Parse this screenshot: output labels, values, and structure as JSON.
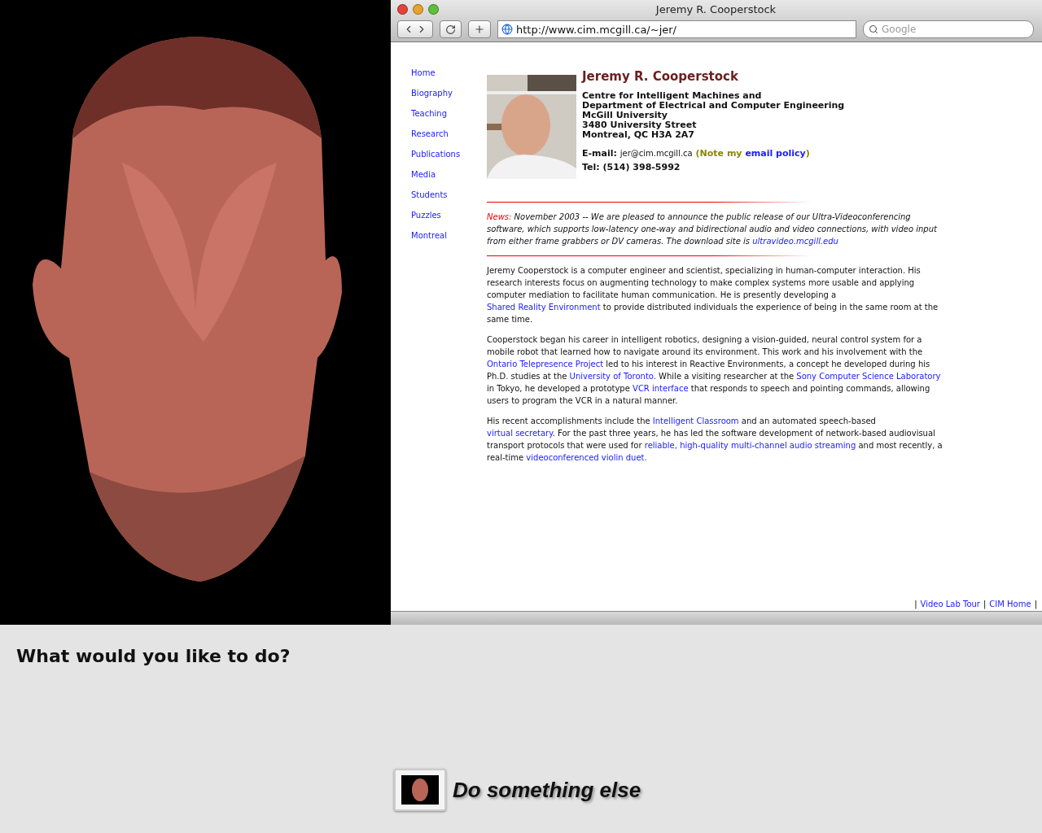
{
  "browser": {
    "title": "Jeremy R. Cooperstock",
    "url": "http://www.cim.mcgill.ca/~jer/",
    "search_placeholder": "Google"
  },
  "nav": [
    "Home",
    "Biography",
    "Teaching",
    "Research",
    "Publications",
    "Media",
    "Students",
    "Puzzles",
    "Montreal"
  ],
  "profile": {
    "name": "Jeremy R. Cooperstock",
    "address_lines": [
      "Centre for Intelligent Machines and",
      "Department of Electrical and Computer Engineering",
      "McGill University",
      "3480 University Street",
      "Montreal, QC H3A 2A7"
    ],
    "email_label": "E-mail:",
    "email": "jer@cim.mcgill.ca",
    "note_open": "(Note my",
    "note_link": "email policy",
    "note_close": ")",
    "tel": "Tel: (514) 398-5992"
  },
  "news": {
    "label": "News:",
    "segments": [
      {
        "kind": "text",
        "text": "November 2003 -- We are pleased to announce the public release of our Ultra-Videoconferencing software, which supports low-latency one-way and bidirectional audio and video connections, with video input from either frame grabbers or DV cameras. The download site is "
      },
      {
        "kind": "link",
        "text": "ultravideo.mcgill.edu"
      }
    ]
  },
  "paragraphs": [
    [
      {
        "kind": "text",
        "text": "Jeremy Cooperstock is a computer engineer and scientist, specializing in human-computer interaction. His research interests focus on augmenting technology to make complex systems more usable and applying computer mediation to facilitate human communication. He is presently developing a "
      },
      {
        "kind": "link",
        "text": "Shared Reality Environment"
      },
      {
        "kind": "text",
        "text": " to provide distributed individuals the experience of being in the same room at the same time."
      }
    ],
    [
      {
        "kind": "text",
        "text": "Cooperstock began his career in intelligent robotics, designing a vision-guided, neural control system for a mobile robot that learned how to navigate around its environment. This work and his involvement with the "
      },
      {
        "kind": "link",
        "text": "Ontario Telepresence Project"
      },
      {
        "kind": "text",
        "text": " led to his interest in Reactive Environments, a concept he developed during his Ph.D. studies at the "
      },
      {
        "kind": "link",
        "text": "University of Toronto"
      },
      {
        "kind": "text",
        "text": ". While a visiting researcher at the "
      },
      {
        "kind": "link",
        "text": "Sony Computer Science Laboratory"
      },
      {
        "kind": "text",
        "text": " in Tokyo, he developed a prototype "
      },
      {
        "kind": "link",
        "text": "VCR interface"
      },
      {
        "kind": "text",
        "text": " that responds to speech and pointing commands, allowing users to program the VCR in a natural manner."
      }
    ],
    [
      {
        "kind": "text",
        "text": "His recent accomplishments include the "
      },
      {
        "kind": "link",
        "text": "Intelligent Classroom"
      },
      {
        "kind": "text",
        "text": " and an automated speech-based "
      },
      {
        "kind": "link",
        "text": "virtual secretary"
      },
      {
        "kind": "text",
        "text": ". For the past three years, he has led the software development of network-based audiovisual transport protocols that were used for "
      },
      {
        "kind": "link",
        "text": "reliable, high-quality multi-channel audio streaming"
      },
      {
        "kind": "text",
        "text": " and most recently, a real-time "
      },
      {
        "kind": "link",
        "text": "videoconferenced violin duet."
      }
    ]
  ],
  "footer": [
    {
      "kind": "sep",
      "text": "|"
    },
    {
      "kind": "link",
      "text": "Video Lab Tour"
    },
    {
      "kind": "sep",
      "text": "|"
    },
    {
      "kind": "link",
      "text": "CIM Home"
    },
    {
      "kind": "sep",
      "text": "|"
    }
  ],
  "prompt": "What would you like to do?",
  "action": {
    "label": "Do something else"
  }
}
